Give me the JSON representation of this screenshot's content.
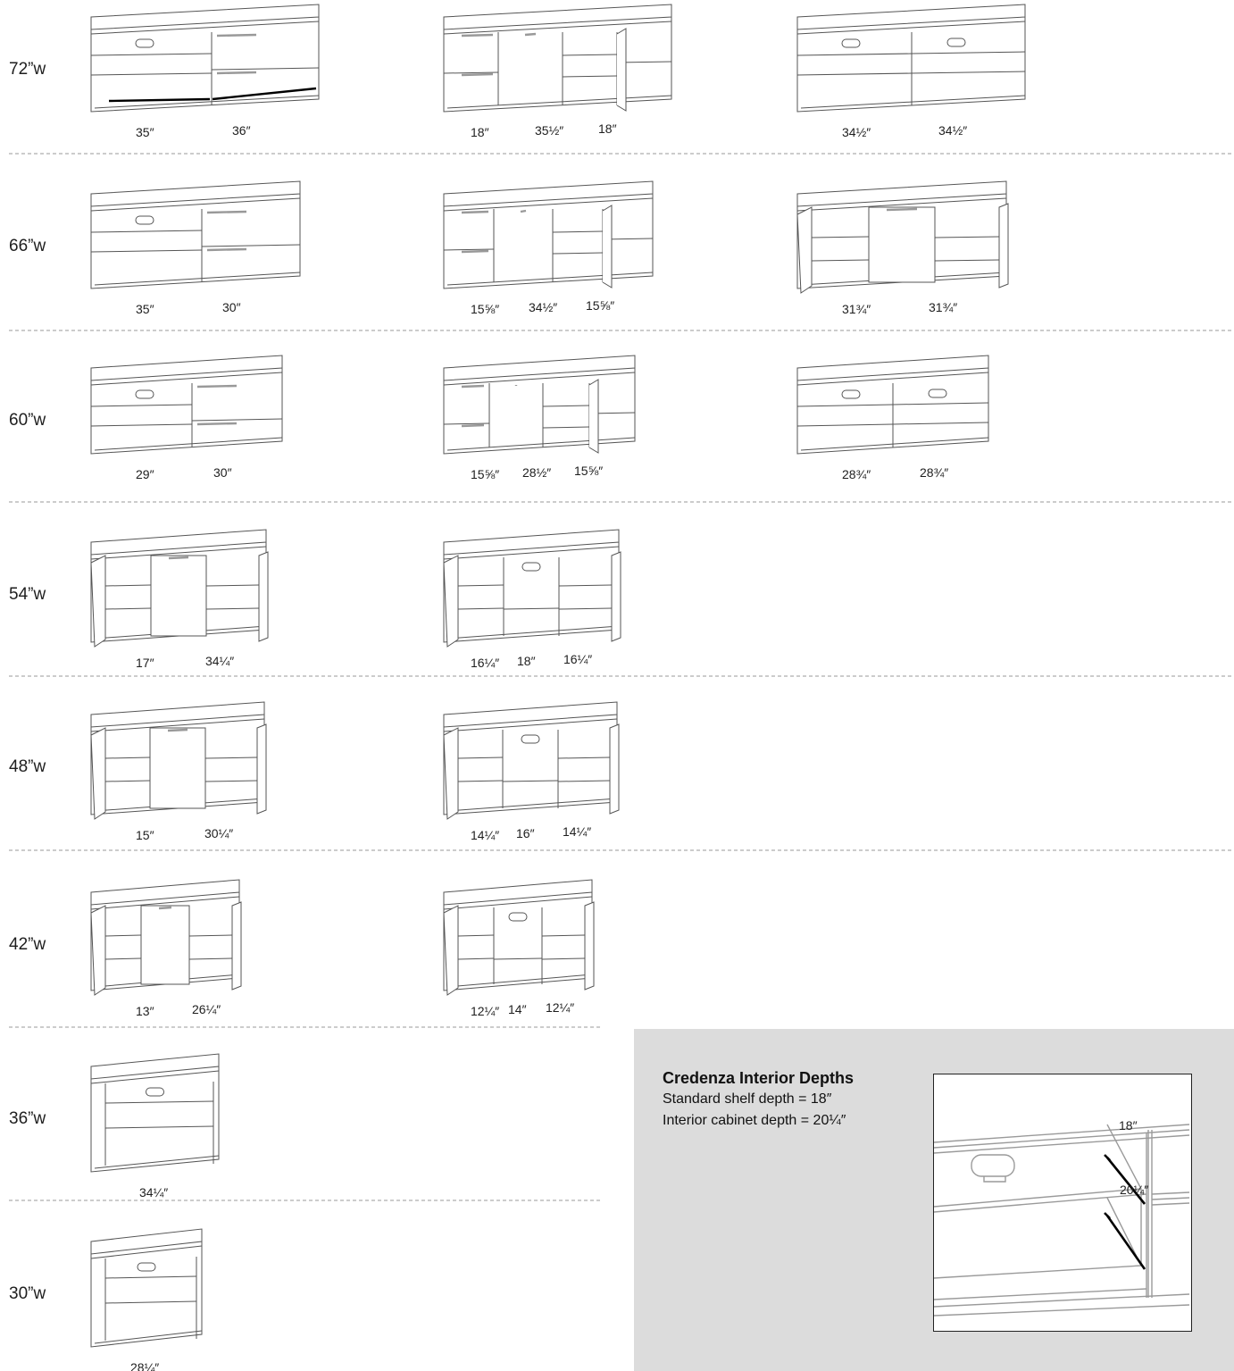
{
  "rows": [
    {
      "width_label": "72”w",
      "units": [
        {
          "kind": "drawer-file",
          "dims": [
            "35″",
            "36″"
          ]
        },
        {
          "kind": "file-door-file",
          "dims": [
            "18″",
            "35½″",
            "18″"
          ]
        },
        {
          "kind": "open-open",
          "dims": [
            "34½″",
            "34½″"
          ]
        }
      ]
    },
    {
      "width_label": "66”w",
      "units": [
        {
          "kind": "drawer-file",
          "dims": [
            "35″",
            "30″"
          ]
        },
        {
          "kind": "file-door-file",
          "dims": [
            "15⅝″",
            "34½″",
            "15⅝″"
          ]
        },
        {
          "kind": "door-door",
          "dims": [
            "31¾″",
            "31¾″"
          ]
        }
      ]
    },
    {
      "width_label": "60”w",
      "units": [
        {
          "kind": "drawer-file",
          "dims": [
            "29″",
            "30″"
          ]
        },
        {
          "kind": "file-door-file",
          "dims": [
            "15⅝″",
            "28½″",
            "15⅝″"
          ]
        },
        {
          "kind": "open-open",
          "dims": [
            "28¾″",
            "28¾″"
          ]
        }
      ]
    },
    {
      "width_label": "54”w",
      "units": [
        {
          "kind": "door-door",
          "dims": [
            "17″",
            "34¼″"
          ]
        },
        {
          "kind": "three-bay",
          "dims": [
            "16¼″",
            "18″",
            "16¼″"
          ]
        }
      ]
    },
    {
      "width_label": "48”w",
      "units": [
        {
          "kind": "door-door",
          "dims": [
            "15″",
            "30¼″"
          ]
        },
        {
          "kind": "three-bay",
          "dims": [
            "14¼″",
            "16″",
            "14¼″"
          ]
        }
      ]
    },
    {
      "width_label": "42”w",
      "units": [
        {
          "kind": "door-door",
          "dims": [
            "13″",
            "26¼″"
          ]
        },
        {
          "kind": "three-bay",
          "dims": [
            "12¼″",
            "14″",
            "12¼″"
          ]
        }
      ]
    },
    {
      "width_label": "36”w",
      "units": [
        {
          "kind": "single-open",
          "dims": [
            "34¼″"
          ]
        }
      ]
    },
    {
      "width_label": "30”w",
      "units": [
        {
          "kind": "single-open",
          "dims": [
            "28¼″"
          ]
        }
      ]
    }
  ],
  "info": {
    "title": "Credenza Interior Depths",
    "lines": [
      "Standard shelf depth = 18″",
      "Interior cabinet depth = 20¼″"
    ],
    "diagram_labels": [
      "18″",
      "20¼″"
    ]
  }
}
